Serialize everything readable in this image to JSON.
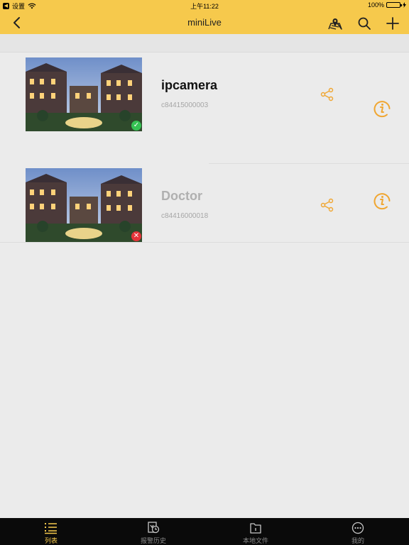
{
  "status_bar": {
    "back_app_label": "设置",
    "time": "上午11:22",
    "battery_text": "100%",
    "battery_level": 1.0
  },
  "nav": {
    "title": "miniLive",
    "icons": [
      "chevron-left-icon",
      "map-pin-icon",
      "search-icon",
      "plus-icon"
    ]
  },
  "devices": [
    {
      "name": "ipcamera",
      "id": "c84415000003",
      "status": "online",
      "status_glyph": "✓"
    },
    {
      "name": "Doctor",
      "id": "c84416000018",
      "status": "offline",
      "status_glyph": "✕"
    }
  ],
  "tabs": [
    {
      "label": "列表",
      "icon": "list-icon",
      "active": true
    },
    {
      "label": "报警历史",
      "icon": "alarm-history-icon",
      "active": false
    },
    {
      "label": "本地文件",
      "icon": "folder-icon",
      "active": false
    },
    {
      "label": "我的",
      "icon": "more-dots-icon",
      "active": false
    }
  ],
  "colors": {
    "accent": "#f6c94c",
    "icon_orange": "#f0a631",
    "online": "#35c253",
    "offline": "#e5343a",
    "tab_bar": "#0a0a0a"
  }
}
